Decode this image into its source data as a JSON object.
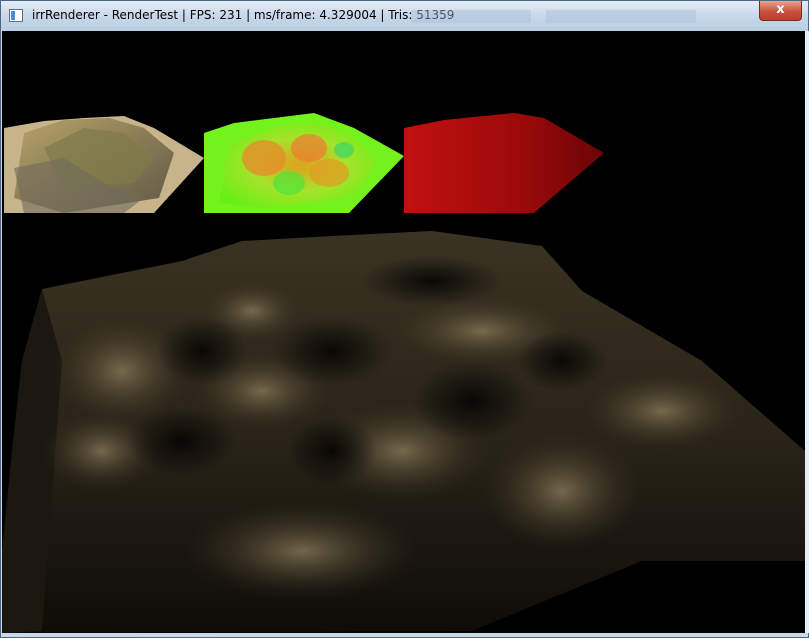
{
  "window": {
    "title": "irrRenderer - RenderTest | FPS: 231 | ms/frame: 4.329004 | Tris: 51359",
    "close_glyph": "x"
  },
  "viewport": {
    "thumbnails": [
      {
        "name": "diffuse-buffer-thumbnail",
        "buffer": "diffuse",
        "color": "#9c8c5a"
      },
      {
        "name": "normal-buffer-thumbnail",
        "buffer": "normals",
        "color": "#7cf21a"
      },
      {
        "name": "depth-buffer-thumbnail",
        "buffer": "depth",
        "color": "#b01010"
      }
    ],
    "scene": "terrain",
    "background": "#000000"
  }
}
